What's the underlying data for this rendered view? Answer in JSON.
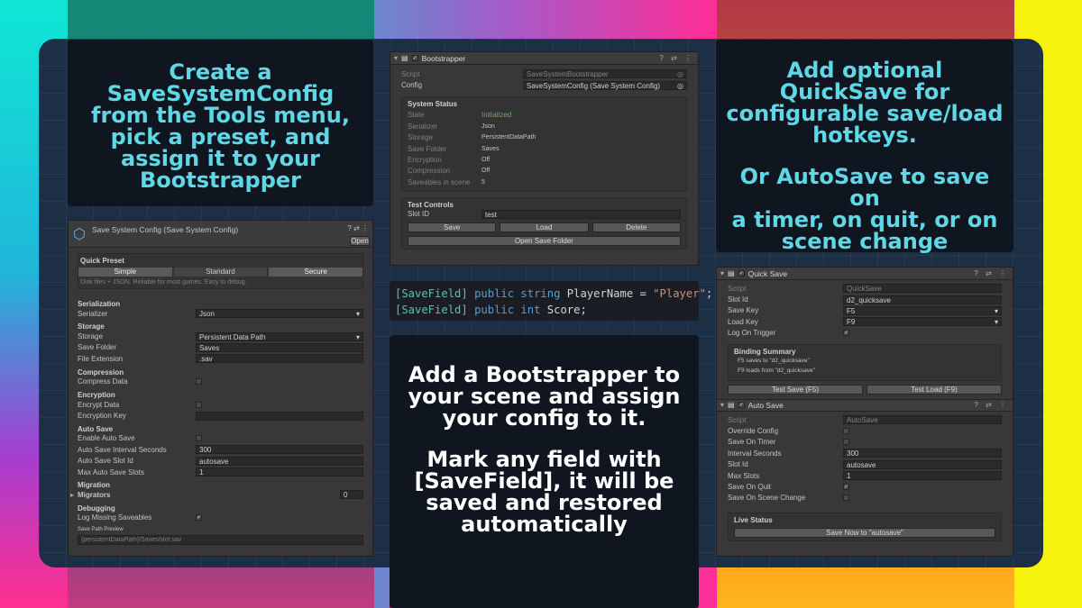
{
  "cards": {
    "config_instructions": [
      "Create a",
      "SaveSystemConfig",
      "from the Tools menu,",
      "pick a preset, and",
      "assign it to your",
      "Bootstrapper"
    ],
    "quicksave_instructions": [
      "Add optional",
      "QuickSave for",
      "configurable save/load",
      "hotkeys."
    ],
    "autosave_instructions": [
      "Or AutoSave to save on",
      "a timer, on quit, or on",
      "scene change"
    ],
    "bootstrapper_instructions": [
      "Add a Bootstrapper to",
      "your scene and assign",
      "your config to it."
    ],
    "savefield_instructions": [
      "Mark any field with",
      "[SaveField], it will be",
      "saved and restored",
      "automatically"
    ]
  },
  "bootstrapper": {
    "title": "Bootstrapper",
    "script_label": "Script",
    "script_value": "SaveSystemBootstrapper",
    "config_label": "Config",
    "config_value": "SaveSystemConfig (Save System Config)",
    "status_header": "System Status",
    "status": [
      {
        "label": "State",
        "value": "Initialized"
      },
      {
        "label": "Serializer",
        "value": "Json"
      },
      {
        "label": "Storage",
        "value": "PersistentDataPath"
      },
      {
        "label": "Save Folder",
        "value": "Saves"
      },
      {
        "label": "Encryption",
        "value": "Off"
      },
      {
        "label": "Compression",
        "value": "Off"
      },
      {
        "label": "Saveables in scene",
        "value": "5"
      }
    ],
    "test_header": "Test Controls",
    "slot_label": "Slot ID",
    "slot_value": "test",
    "save_label": "Save",
    "load_label": "Load",
    "delete_label": "Delete",
    "open_folder_label": "Open Save Folder"
  },
  "code": {
    "line1": {
      "attr": "[SaveField]",
      "kw": "public string",
      "rest": "PlayerName =",
      "str": "\"Player\"",
      "end": ";"
    },
    "line2": {
      "attr": "[SaveField]",
      "kw": "public int",
      "rest": "Score;"
    }
  },
  "config": {
    "title": "Save System Config (Save System Config)",
    "open_label": "Open",
    "quick_preset": "Quick Preset",
    "presets": [
      "Simple",
      "Standard",
      "Secure"
    ],
    "preset_desc": "Disk files + JSON. Reliable for most games. Easy to debug.",
    "serialization": "Serialization",
    "serializer_label": "Serializer",
    "serializer_value": "Json",
    "storage_header": "Storage",
    "storage_label": "Storage",
    "storage_value": "Persistent Data Path",
    "save_folder_label": "Save Folder",
    "save_folder_value": "Saves",
    "file_ext_label": "File Extension",
    "file_ext_value": ".sav",
    "compression_header": "Compression",
    "compress_label": "Compress Data",
    "encryption_header": "Encryption",
    "encrypt_label": "Encrypt Data",
    "encrypt_key_label": "Encryption Key",
    "autosave_header": "Auto Save",
    "enable_autosave_label": "Enable Auto Save",
    "interval_label": "Auto Save Interval Seconds",
    "interval_value": "300",
    "slot_id_label": "Auto Save Slot Id",
    "slot_id_value": "autosave",
    "max_slots_label": "Max Auto Save Slots",
    "max_slots_value": "1",
    "migration_header": "Migration",
    "migrators_label": "Migrators",
    "migrators_value": "0",
    "debugging_header": "Debugging",
    "log_missing_label": "Log Missing Saveables",
    "path_preview_label": "Save Path Preview",
    "path_preview_value": "{persistentDataPath}/Saves/slot.sav"
  },
  "quicksave": {
    "title": "Quick Save",
    "script_label": "Script",
    "script_value": "QuickSave",
    "slot_label": "Slot Id",
    "slot_value": "d2_quicksave",
    "save_key_label": "Save Key",
    "save_key_value": "F5",
    "load_key_label": "Load Key",
    "load_key_value": "F9",
    "log_trigger_label": "Log On Trigger",
    "binding_header": "Binding Summary",
    "binding_1": "F5  saves to \"d2_quicksave\"",
    "binding_2": "F9  loads from \"d2_quicksave\"",
    "test_save_label": "Test Save (F5)",
    "test_load_label": "Test Load (F9)"
  },
  "autosave": {
    "title": "Auto Save",
    "script_label": "Script",
    "script_value": "AutoSave",
    "override_label": "Override Config",
    "timer_label": "Save On Timer",
    "interval_label": "Interval Seconds",
    "interval_value": "300",
    "slot_label": "Slot Id",
    "slot_value": "autosave",
    "max_slots_label": "Max Slots",
    "max_slots_value": "1",
    "quit_label": "Save On Quit",
    "scene_change_label": "Save On Scene Change",
    "live_status_header": "Live Status",
    "save_now_label": "Save Now to \"autosave\""
  },
  "icons": {
    "checkmark": "✓",
    "header_icons": "? ⇄ ⋮"
  }
}
